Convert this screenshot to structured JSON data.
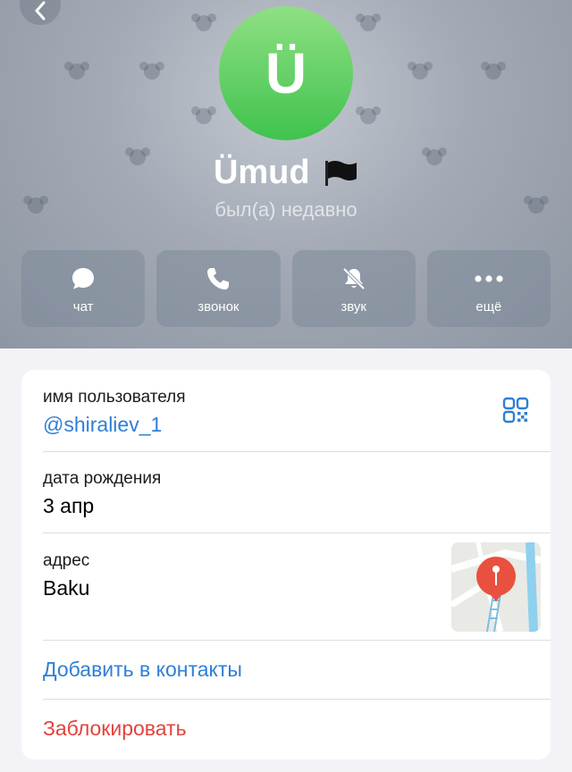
{
  "profile": {
    "avatar_letter": "Ü",
    "name": "Ümud",
    "status": "был(а) недавно",
    "avatar_color": "#4cc75a"
  },
  "actions": [
    {
      "label": "чат",
      "icon": "chat-bubble-icon"
    },
    {
      "label": "звонок",
      "icon": "phone-icon"
    },
    {
      "label": "звук",
      "icon": "bell-slash-icon"
    },
    {
      "label": "ещё",
      "icon": "more-dots-icon"
    }
  ],
  "info": {
    "username_label": "имя пользователя",
    "username": "@shiraliev_1",
    "birthday_label": "дата рождения",
    "birthday": "3 апр",
    "address_label": "адрес",
    "address": "Baku",
    "add_contact": "Добавить в контакты",
    "block": "Заблокировать"
  },
  "colors": {
    "link": "#2f7fd6",
    "danger": "#e0443e",
    "pin": "#e9503f"
  }
}
